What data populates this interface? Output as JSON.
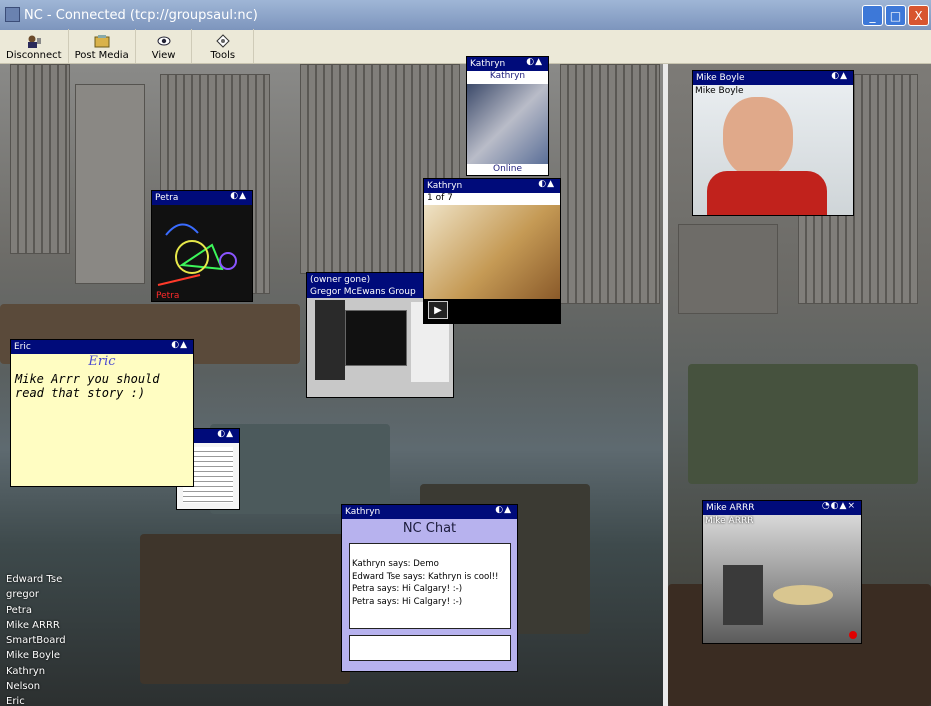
{
  "window": {
    "title": "NC - Connected (tcp://groupsaul:nc)",
    "minimize": "_",
    "maximize": "□",
    "close": "X"
  },
  "toolbar": {
    "items": [
      {
        "label": "Disconnect",
        "icon": "disconnect-icon"
      },
      {
        "label": "Post Media",
        "icon": "post-media-icon"
      },
      {
        "label": "View",
        "icon": "eye-icon"
      },
      {
        "label": "Tools",
        "icon": "tools-icon"
      }
    ]
  },
  "windows": {
    "kathryn_top": {
      "title": "Kathryn",
      "name": "Kathryn",
      "status": "Online"
    },
    "mike_boyle": {
      "title": "Mike Boyle",
      "name": "Mike Boyle"
    },
    "petra": {
      "title": "Petra",
      "caption": "Petra"
    },
    "kathryn_slides": {
      "title": "Kathryn",
      "counter": "1 of 7"
    },
    "owner_gone": {
      "title": "(owner gone)",
      "subtitle": "Gregor McEwans Group"
    },
    "eric": {
      "title": "Eric",
      "header": "Eric",
      "text": "Mike Arrr you should read that story :)"
    },
    "chat": {
      "title": "Kathryn",
      "heading": "NC Chat",
      "messages": [
        "Kathryn says: Demo",
        "Edward Tse says: Kathryn is cool!!",
        "Petra says: Hi Calgary! :-)",
        "Petra says: Hi Calgary! :-)"
      ],
      "input_value": ""
    },
    "mike_arrr": {
      "title": "Mike ARRR",
      "name": "Mike ARRR"
    }
  },
  "participants": [
    "Edward Tse",
    "gregor",
    "Petra",
    "Mike ARRR",
    "SmartBoard",
    "Mike Boyle",
    "Kathryn",
    "Nelson",
    "Eric"
  ],
  "colors": {
    "title_bar": "#000b7a",
    "note_bg": "#fffdc2",
    "chat_bg": "#b7b2ee"
  }
}
